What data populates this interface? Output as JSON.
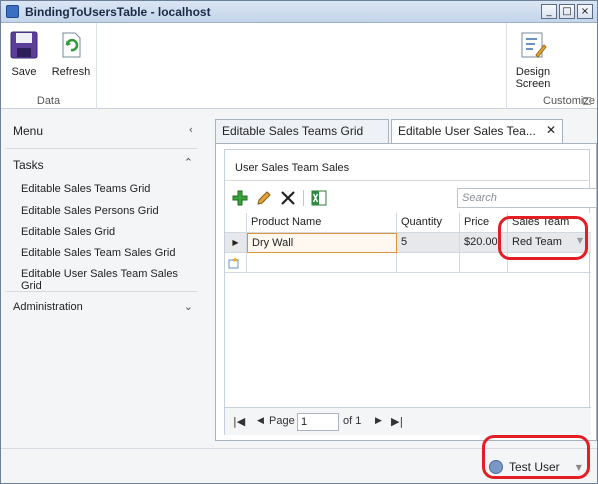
{
  "window": {
    "title": "BindingToUsersTable - localhost",
    "controls": [
      "_",
      "□",
      "×"
    ]
  },
  "ribbon": {
    "data_group": {
      "label": "Data",
      "save_label": "Save",
      "refresh_label": "Refresh"
    },
    "customize_group": {
      "label": "Customize",
      "design_label_1": "Design",
      "design_label_2": "Screen"
    }
  },
  "nav": {
    "menu_label": "Menu",
    "tasks_label": "Tasks",
    "tasks": [
      "Editable Sales Teams Grid",
      "Editable Sales Persons Grid",
      "Editable Sales Grid",
      "Editable Sales Team Sales Grid",
      "Editable User Sales Team Sales Grid"
    ],
    "admin_label": "Administration"
  },
  "tabs": [
    {
      "label": "Editable Sales Teams Grid",
      "active": false
    },
    {
      "label": "Editable User Sales Tea...",
      "active": true
    }
  ],
  "screen": {
    "group_title": "User Sales Team Sales",
    "search_placeholder": "Search",
    "columns": [
      "Product Name",
      "Quantity",
      "Price",
      "Sales Team"
    ],
    "rows": [
      {
        "product": "Dry Wall",
        "quantity": "5",
        "price": "$20.00",
        "team": "Red Team"
      }
    ],
    "pager": {
      "page_label": "Page",
      "page_value": "1",
      "of_label": "of 1"
    }
  },
  "status": {
    "user": "Test User"
  },
  "colors": {
    "annotation": "#e31e24",
    "edit_border": "#e0923a",
    "accent": "#3a6fc4"
  }
}
